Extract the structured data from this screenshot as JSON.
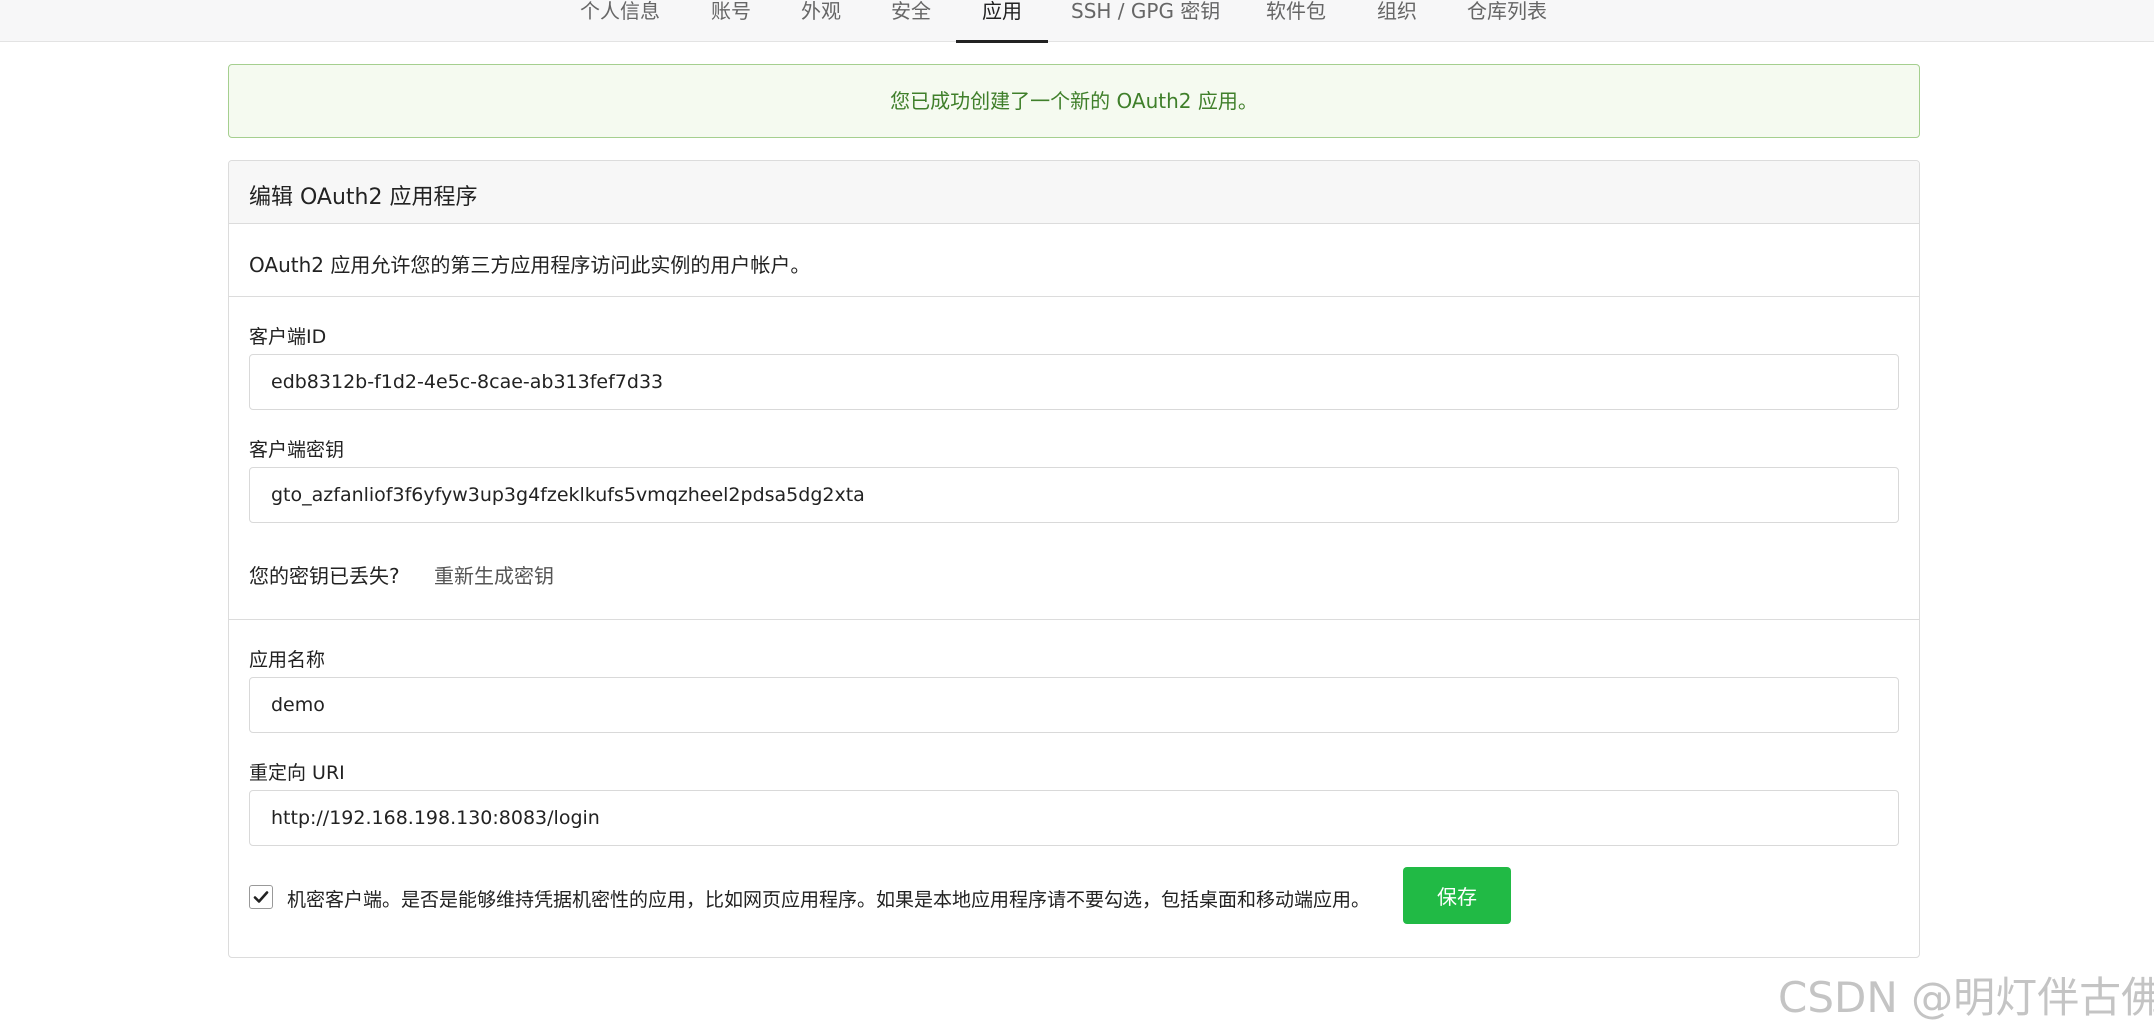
{
  "tabs": [
    {
      "label": "个人信息"
    },
    {
      "label": "账号"
    },
    {
      "label": "外观"
    },
    {
      "label": "安全"
    },
    {
      "label": "应用",
      "active": true
    },
    {
      "label": "SSH / GPG 密钥"
    },
    {
      "label": "软件包"
    },
    {
      "label": "组织"
    },
    {
      "label": "仓库列表"
    }
  ],
  "alert": {
    "message": "您已成功创建了一个新的 OAuth2 应用。"
  },
  "panel": {
    "title": "编辑 OAuth2 应用程序",
    "description": "OAuth2 应用允许您的第三方应用程序访问此实例的用户帐户。",
    "client_id": {
      "label": "客户端ID",
      "value": "edb8312b-f1d2-4e5c-8cae-ab313fef7d33"
    },
    "client_secret": {
      "label": "客户端密钥",
      "value": "gto_azfanliof3f6yfyw3up3g4fzeklkufs5vmqzheel2pdsa5dg2xta"
    },
    "secret_lost": {
      "question": "您的密钥已丢失?",
      "regenerate_link": "重新生成密钥"
    },
    "app_name": {
      "label": "应用名称",
      "value": "demo"
    },
    "redirect_uri": {
      "label": "重定向 URI",
      "value": "http://192.168.198.130:8083/login"
    },
    "confidential": {
      "checked": true,
      "label": "机密客户端。是否是能够维持凭据机密性的应用，比如网页应用程序。如果是本地应用程序请不要勾选，包括桌面和移动端应用。"
    },
    "save_label": "保存"
  },
  "watermark": "CSDN @明灯伴古佛",
  "colors": {
    "save_button": "#21ba45",
    "alert_bg": "#f5faf0",
    "alert_text": "#3f7f2a"
  }
}
